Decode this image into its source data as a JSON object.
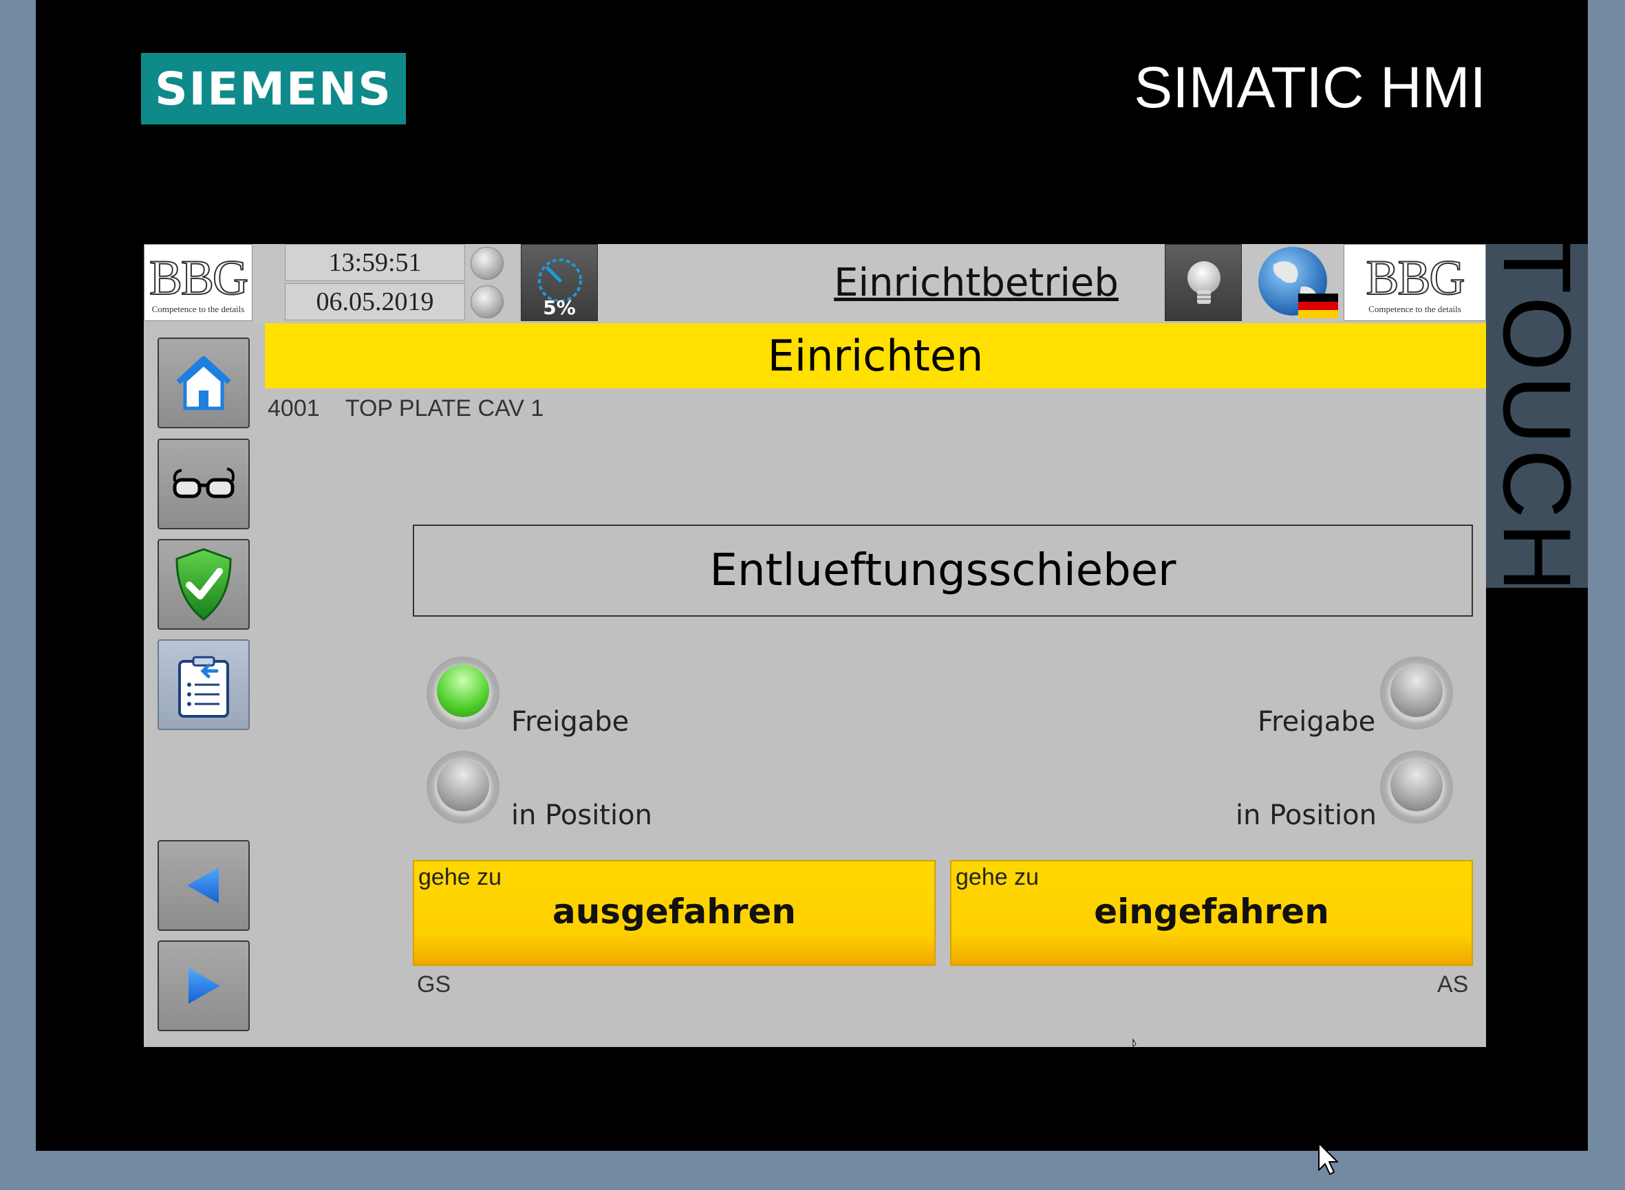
{
  "bezel": {
    "brand": "SIEMENS",
    "product": "SIMATIC HMI",
    "touch_label": "TOUCH"
  },
  "header": {
    "logo_left": {
      "mark": "BBG",
      "tagline": "Competence to the details"
    },
    "time": "13:59:51",
    "date": "06.05.2019",
    "gauge_value": "5%",
    "mode": "Einrichtbetrieb",
    "logo_right": {
      "mark": "BBG",
      "tagline": "Competence to the details"
    }
  },
  "screen": {
    "title": "Einrichten",
    "recipe_number": "4001",
    "recipe_name": "TOP PLATE CAV 1"
  },
  "nav": {
    "items": [
      {
        "name": "home",
        "icon": "home-icon"
      },
      {
        "name": "view",
        "icon": "glasses-icon"
      },
      {
        "name": "confirm",
        "icon": "shield-check-icon"
      },
      {
        "name": "list",
        "icon": "list-back-icon",
        "active": true
      },
      {
        "name": "previous",
        "icon": "arrow-left-icon"
      },
      {
        "name": "next",
        "icon": "arrow-right-icon"
      }
    ]
  },
  "panel": {
    "title": "Entlueftungsschieber",
    "left": {
      "release_label": "Freigabe",
      "release_state": "on",
      "position_label": "in Position",
      "position_state": "off"
    },
    "right": {
      "release_label": "Freigabe",
      "release_state": "off",
      "position_label": "in Position",
      "position_state": "off"
    },
    "buttons": [
      {
        "prefix": "gehe zu",
        "label": "ausgefahren"
      },
      {
        "prefix": "gehe zu",
        "label": "eingefahren"
      }
    ],
    "left_side": "GS",
    "right_side": "AS"
  },
  "colors": {
    "accent_yellow": "#ffe000",
    "button_yellow": "#ffd000",
    "led_green": "#4fcf2a",
    "siemens_teal": "#0f8a8a"
  }
}
